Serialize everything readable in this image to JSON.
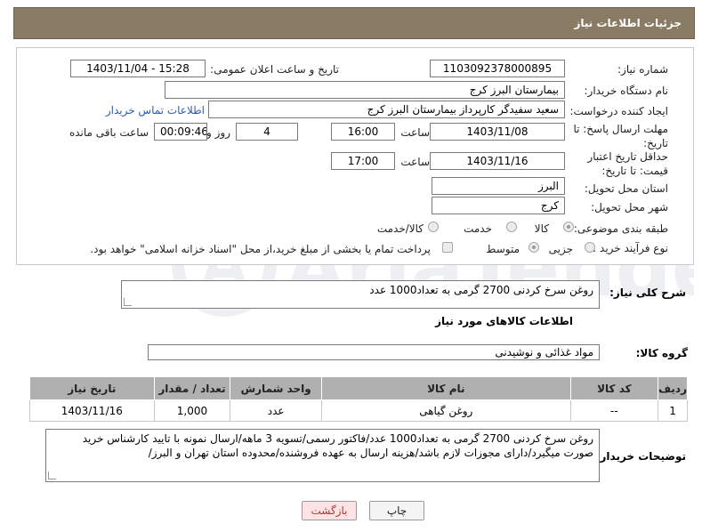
{
  "header": {
    "title": "جزئیات اطلاعات نیاز"
  },
  "form": {
    "need_number_label": "شماره نیاز:",
    "need_number": "1103092378000895",
    "announce_label": "تاریخ و ساعت اعلان عمومی:",
    "announce_value": "1403/11/04 - 15:28",
    "buyer_org_label": "نام دستگاه خریدار:",
    "buyer_org": "بیمارستان البرز کرج",
    "creator_label": "ایجاد کننده درخواست:",
    "creator": "سعید سفیدگر کارپرداز بیمارستان البرز کرج",
    "contact_link": "اطلاعات تماس خریدار",
    "reply_deadline_label": "مهلت ارسال پاسخ: تا تاریخ:",
    "reply_date": "1403/11/08",
    "time_label": "ساعت",
    "reply_time": "16:00",
    "days_value": "4",
    "days_label": "روز و",
    "remaining_time": "00:09:46",
    "remaining_label": "ساعت باقی مانده",
    "price_valid_label": "حداقل تاریخ اعتبار قیمت: تا تاریخ:",
    "price_valid_date": "1403/11/16",
    "price_valid_time": "17:00",
    "province_label": "استان محل تحویل:",
    "province": "البرز",
    "city_label": "شهر محل تحویل:",
    "city": "کرج",
    "category_label": "طبقه بندی موضوعی:",
    "category_options": [
      "کالا",
      "خدمت",
      "کالا/خدمت"
    ],
    "category_selected": "کالا",
    "process_label": "نوع فرآیند خرید :",
    "process_options": [
      "جزیی",
      "متوسط"
    ],
    "payment_note": "پرداخت تمام یا بخشی از مبلغ خرید،از محل \"اسناد خزانه اسلامی\" خواهد بود."
  },
  "summary": {
    "label": "شرح کلی نیاز:",
    "text": "روغن سرخ کردنی 2700 گرمی به تعداد1000 عدد"
  },
  "goods": {
    "section_title": "اطلاعات کالاهای مورد نیاز",
    "group_label": "گروه کالا:",
    "group_value": "مواد غذائی و نوشیدنی",
    "columns": [
      "ردیف",
      "کد کالا",
      "نام کالا",
      "واحد شمارش",
      "تعداد / مقدار",
      "تاریخ نیاز"
    ],
    "rows": [
      [
        "1",
        "--",
        "روغن گیاهی",
        "عدد",
        "1,000",
        "1403/11/16"
      ]
    ]
  },
  "buyer_notes": {
    "label": "توضیحات خریدار:",
    "text": "روغن سرخ کردنی 2700 گرمی به تعداد1000 عدد/فاکتور رسمی/تسویه 3 ماهه/ارسال نمونه با تایید کارشناس خرید صورت میگیرد/دارای مجوزات لازم باشد/هزینه ارسال به عهده فروشنده/محدوده استان تهران و البرز/"
  },
  "buttons": {
    "print": "چاپ",
    "back": "بازگشت"
  }
}
